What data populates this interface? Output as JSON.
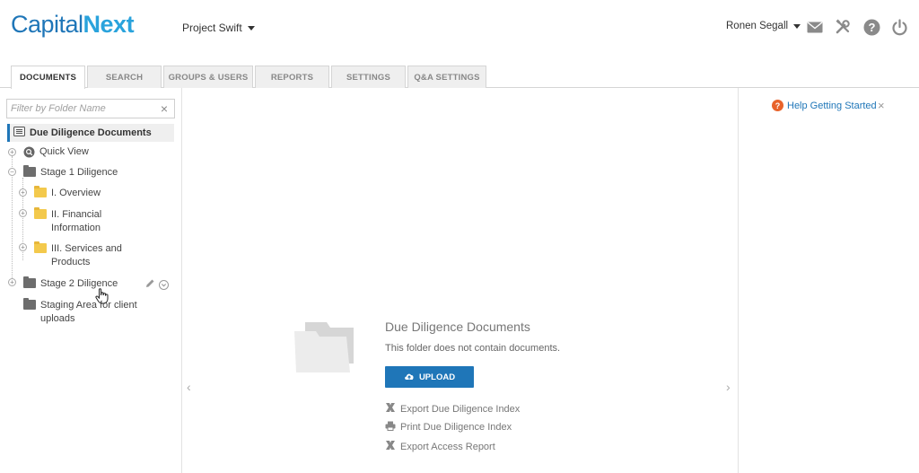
{
  "header": {
    "logo_part1": "Capital",
    "logo_part2": "Next",
    "project": "Project Swift",
    "user": "Ronen Segall",
    "icons": [
      "mail-icon",
      "tools-icon",
      "help-icon",
      "power-icon"
    ]
  },
  "tabs": [
    {
      "label": "DOCUMENTS",
      "active": true
    },
    {
      "label": "SEARCH",
      "active": false
    },
    {
      "label": "GROUPS & USERS",
      "active": false
    },
    {
      "label": "REPORTS",
      "active": false
    },
    {
      "label": "SETTINGS",
      "active": false
    },
    {
      "label": "Q&A SETTINGS",
      "active": false
    }
  ],
  "sidebar": {
    "filter_placeholder": "Filter by Folder Name",
    "filter_clear": "×",
    "root": "Due Diligence Documents",
    "quick_view": "Quick View",
    "stage1": "Stage 1 Diligence",
    "overview": "I. Overview",
    "financial": "II. Financial Information",
    "services": "III. Services and Products",
    "stage2": "Stage 2 Diligence",
    "staging": "Staging Area for client uploads"
  },
  "main": {
    "folder_title": "Due Diligence Documents",
    "empty_message": "This folder does not contain documents.",
    "upload_label": "UPLOAD",
    "export_index": "Export Due Diligence Index",
    "print_index": "Print Due Diligence Index",
    "export_access": "Export Access Report"
  },
  "help": {
    "label": "Help Getting Started",
    "close": "×"
  },
  "colors": {
    "brand_dark": "#1f76b8",
    "brand_light": "#2aa3dc",
    "help_orange": "#e8632b"
  }
}
